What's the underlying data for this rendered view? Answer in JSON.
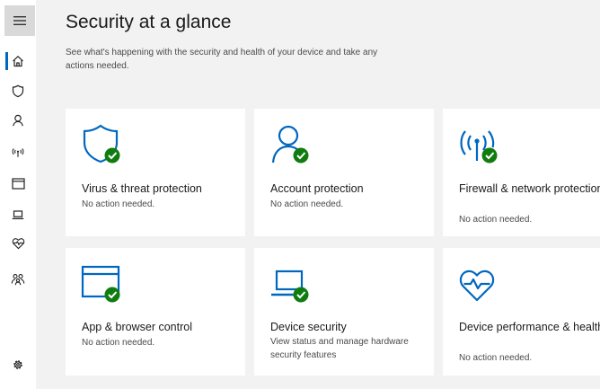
{
  "page": {
    "title": "Security at a glance",
    "subtitle": "See what's happening with the security and health of your device and take any actions needed."
  },
  "navigation": {
    "items": [
      {
        "name": "menu",
        "icon": "hamburger-menu-icon"
      },
      {
        "name": "home",
        "icon": "home-icon",
        "selected": true
      },
      {
        "name": "virus-threat-protection",
        "icon": "shield-icon"
      },
      {
        "name": "account-protection",
        "icon": "person-icon"
      },
      {
        "name": "firewall-network",
        "icon": "wifi-antenna-icon"
      },
      {
        "name": "app-browser-control",
        "icon": "browser-window-icon"
      },
      {
        "name": "device-security",
        "icon": "laptop-icon"
      },
      {
        "name": "device-performance",
        "icon": "heart-pulse-icon"
      },
      {
        "name": "family-options",
        "icon": "family-icon"
      },
      {
        "name": "settings",
        "icon": "gear-icon"
      }
    ]
  },
  "cards": [
    {
      "title": "Virus & threat protection",
      "status": "No action needed.",
      "icon": "shield-check-icon"
    },
    {
      "title": "Account protection",
      "status": "No action needed.",
      "icon": "person-check-icon"
    },
    {
      "title": "Firewall & network protection",
      "status": "No action needed.",
      "icon": "antenna-check-icon"
    },
    {
      "title": "App & browser control",
      "status": "No action needed.",
      "icon": "browser-check-icon"
    },
    {
      "title": "Device security",
      "status": "View status and manage hardware security features",
      "icon": "laptop-check-icon"
    },
    {
      "title": "Device performance & health",
      "status": "No action needed.",
      "icon": "heart-pulse-icon"
    }
  ],
  "colors": {
    "accent": "#0067c0",
    "status_ok": "#107c10",
    "content_background": "#f2f2f2",
    "card_background": "#ffffff"
  }
}
